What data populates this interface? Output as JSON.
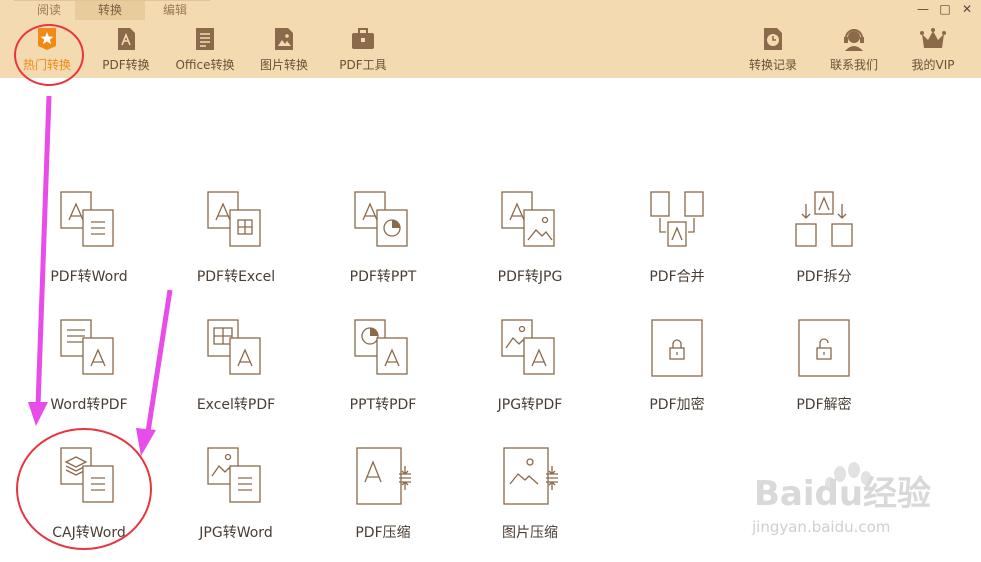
{
  "tabs": [
    {
      "label": "阅读"
    },
    {
      "label": "转换"
    },
    {
      "label": "编辑"
    }
  ],
  "window": {
    "minimize": "—",
    "maximize": "□",
    "close": "✕"
  },
  "toolbar_left": [
    {
      "label": "热门转换",
      "icon": "star-icon"
    },
    {
      "label": "PDF转换",
      "icon": "pdf-icon"
    },
    {
      "label": "Office转换",
      "icon": "document-icon"
    },
    {
      "label": "图片转换",
      "icon": "image-icon"
    },
    {
      "label": "PDF工具",
      "icon": "toolbox-icon"
    }
  ],
  "toolbar_right": [
    {
      "label": "转换记录",
      "icon": "clock-icon"
    },
    {
      "label": "联系我们",
      "icon": "headset-icon"
    },
    {
      "label": "我的VIP",
      "icon": "crown-icon"
    }
  ],
  "items": [
    {
      "label": "PDF转Word",
      "icon": "pdf-to-word-icon"
    },
    {
      "label": "PDF转Excel",
      "icon": "pdf-to-excel-icon"
    },
    {
      "label": "PDF转PPT",
      "icon": "pdf-to-ppt-icon"
    },
    {
      "label": "PDF转JPG",
      "icon": "pdf-to-jpg-icon"
    },
    {
      "label": "PDF合并",
      "icon": "pdf-merge-icon"
    },
    {
      "label": "PDF拆分",
      "icon": "pdf-split-icon"
    },
    {
      "label": "Word转PDF",
      "icon": "word-to-pdf-icon"
    },
    {
      "label": "Excel转PDF",
      "icon": "excel-to-pdf-icon"
    },
    {
      "label": "PPT转PDF",
      "icon": "ppt-to-pdf-icon"
    },
    {
      "label": "JPG转PDF",
      "icon": "jpg-to-pdf-icon"
    },
    {
      "label": "PDF加密",
      "icon": "lock-icon"
    },
    {
      "label": "PDF解密",
      "icon": "unlock-icon"
    },
    {
      "label": "CAJ转Word",
      "icon": "caj-to-word-icon"
    },
    {
      "label": "JPG转Word",
      "icon": "jpg-to-word-icon"
    },
    {
      "label": "PDF压缩",
      "icon": "pdf-compress-icon"
    },
    {
      "label": "图片压缩",
      "icon": "image-compress-icon"
    }
  ],
  "watermark": {
    "brand": "Baidu经验",
    "url": "jingyan.baidu.com"
  },
  "colors": {
    "topbar": "#f3dab0",
    "accent": "#f08a15",
    "icon_stroke": "#8a6a4a",
    "annotation_red": "#e9363e",
    "annotation_arrow": "#e84ce9"
  }
}
